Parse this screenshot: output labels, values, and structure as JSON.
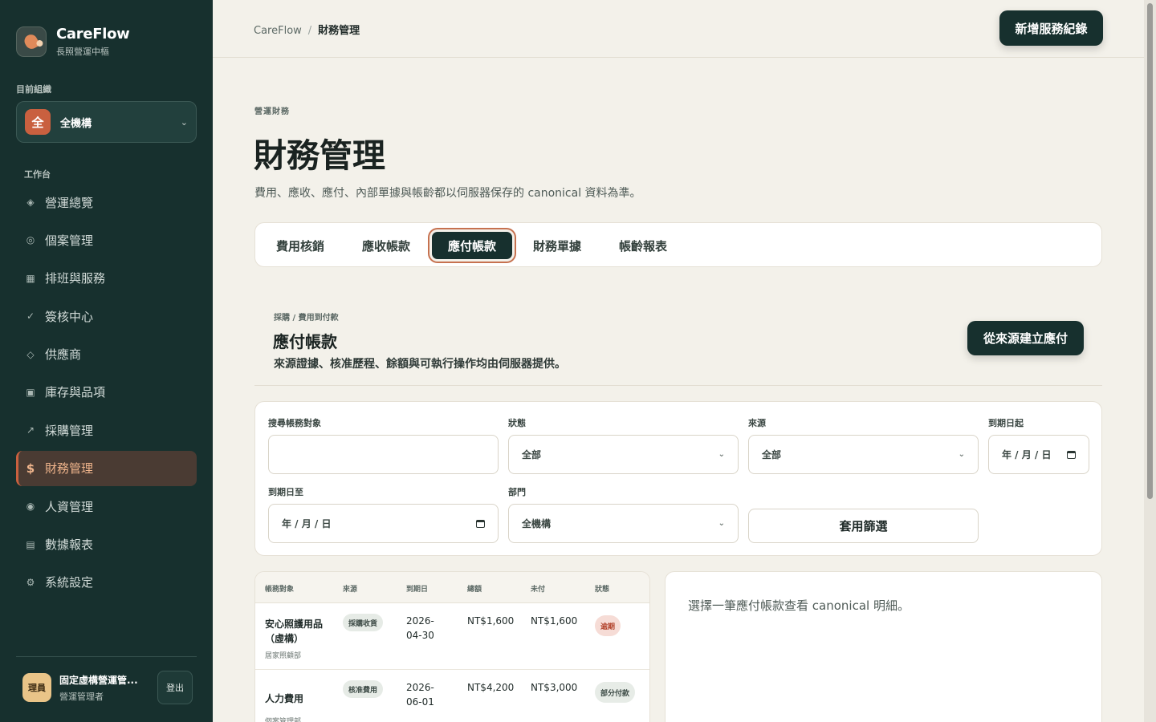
{
  "brand": {
    "name": "CareFlow",
    "subtitle": "長照營運中樞"
  },
  "org": {
    "label": "目前組織",
    "badge": "全",
    "name": "全機構"
  },
  "sidebar": {
    "section_label": "工作台",
    "items": [
      {
        "label": "營運總覽",
        "icon": "diamond-fill-icon",
        "glyph": "◈"
      },
      {
        "label": "個案管理",
        "icon": "target-icon",
        "glyph": "◎"
      },
      {
        "label": "排班與服務",
        "icon": "square-icon",
        "glyph": "▦"
      },
      {
        "label": "簽核中心",
        "icon": "check-icon",
        "glyph": "✓"
      },
      {
        "label": "供應商",
        "icon": "diamond-outline-icon",
        "glyph": "◇"
      },
      {
        "label": "庫存與品項",
        "icon": "box-icon",
        "glyph": "▣"
      },
      {
        "label": "採購管理",
        "icon": "arrow-up-right-icon",
        "glyph": "↗"
      },
      {
        "label": "財務管理",
        "icon": "dollar-icon",
        "glyph": "$",
        "active": true
      },
      {
        "label": "人資管理",
        "icon": "radio-icon",
        "glyph": "◉"
      },
      {
        "label": "數據報表",
        "icon": "list-icon",
        "glyph": "▤"
      },
      {
        "label": "系統設定",
        "icon": "gear-icon",
        "glyph": "⚙"
      }
    ]
  },
  "user": {
    "avatar": "理員",
    "name": "固定虛構營運管...",
    "role": "營運管理者",
    "logout": "登出"
  },
  "header": {
    "breadcrumb": {
      "root": "CareFlow",
      "separator": "/",
      "current": "財務管理"
    },
    "new_button": "新增服務紀錄"
  },
  "page": {
    "eyebrow": "營運財務",
    "title": "財務管理",
    "description": "費用、應收、應付、內部單據與帳齡都以伺服器保存的 canonical 資料為準。"
  },
  "tabs": [
    "費用核銷",
    "應收帳款",
    "應付帳款",
    "財務單據",
    "帳齡報表"
  ],
  "active_tab": "應付帳款",
  "section": {
    "eyebrow": "採購 / 費用到付款",
    "title": "應付帳款",
    "description": "來源證據、核准歷程、餘額與可執行操作均由伺服器提供。",
    "create_button": "從來源建立應付"
  },
  "filters": {
    "search_label": "搜尋帳務對象",
    "search_value": "",
    "status_label": "狀態",
    "status_value": "全部",
    "source_label": "來源",
    "source_value": "全部",
    "due_from_label": "到期日起",
    "due_from_value": "年 / 月 / 日",
    "due_to_label": "到期日至",
    "due_to_value": "年 / 月 / 日",
    "dept_label": "部門",
    "dept_value": "全機構",
    "apply_button": "套用篩選"
  },
  "table": {
    "columns": [
      "帳務對象",
      "來源",
      "到期日",
      "總額",
      "未付",
      "狀態"
    ],
    "rows": [
      {
        "target": "安心照護用品（虛構）",
        "dept": "居家照顧部",
        "source": "採購收貨",
        "due_date": "2026-04-30",
        "due_line1": "2026-",
        "due_line2": "04-30",
        "total": "NT$1,600",
        "unpaid": "NT$1,600",
        "status": "逾期",
        "status_kind": "bad"
      },
      {
        "target": "人力費用",
        "dept": "個案管理部",
        "source": "核准費用",
        "due_date": "2026-06-01",
        "due_line1": "2026-",
        "due_line2": "06-01",
        "total": "NT$4,200",
        "unpaid": "NT$3,000",
        "status": "部分付款",
        "status_kind": "partial"
      }
    ]
  },
  "detail": {
    "placeholder": "選擇一筆應付帳款查看 canonical 明細。"
  },
  "colors": {
    "sidebar": "#17302e",
    "accent": "#c9603f",
    "background": "#f3f1ea",
    "overdue": "#b1412a"
  }
}
